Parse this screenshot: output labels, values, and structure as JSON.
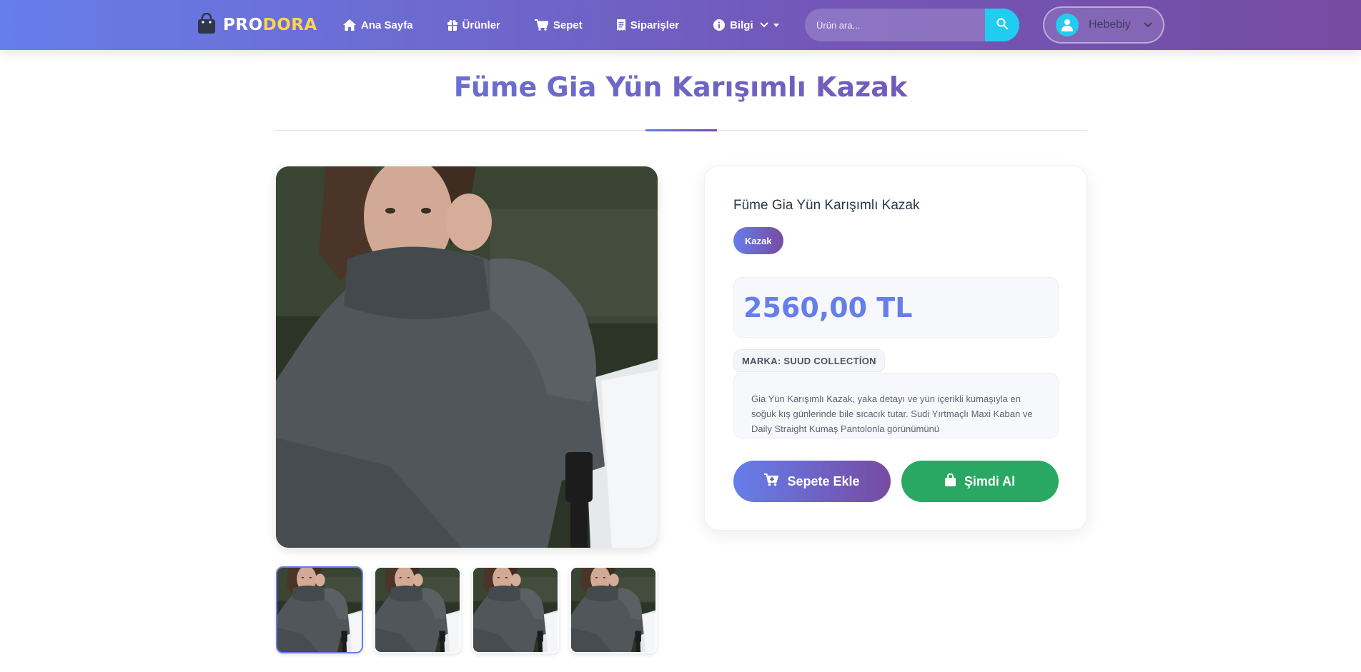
{
  "navbar": {
    "brand_pro": "PRO",
    "brand_dora": "DORA",
    "links": {
      "home": "Ana Sayfa",
      "products": "Ürünler",
      "cart": "Sepet",
      "orders": "Siparişler",
      "info": "Bilgi"
    },
    "search_placeholder": "Ürün ara...",
    "user_name": "Hebebiy"
  },
  "page": {
    "title": "Füme Gia Yün Karışımlı Kazak"
  },
  "gallery": {
    "thumbnail_count": 4,
    "active_thumbnail": 1
  },
  "product": {
    "name": "Füme Gia Yün Karışımlı Kazak",
    "category": "Kazak",
    "price": "2560,00 TL",
    "brand": "MARKA: SUUD COLLECTİON",
    "description": "Gia Yün Karışımlı Kazak, yaka detayı ve yün içerikli kumaşıyla en soğuk kış günlerinde bile sıcacık tutar. Sudi Yırtmaçlı Maxi Kaban ve Daily Straight Kumaş Pantolonla görünümünü",
    "add_to_cart_label": "Sepete Ekle",
    "buy_now_label": "Şimdi Al"
  },
  "colors": {
    "gradient_start": "#667eea",
    "gradient_end": "#764ba2",
    "accent_cyan": "#22ccf0",
    "brand_yellow": "#ffd54a",
    "buy_green": "#28a862"
  }
}
